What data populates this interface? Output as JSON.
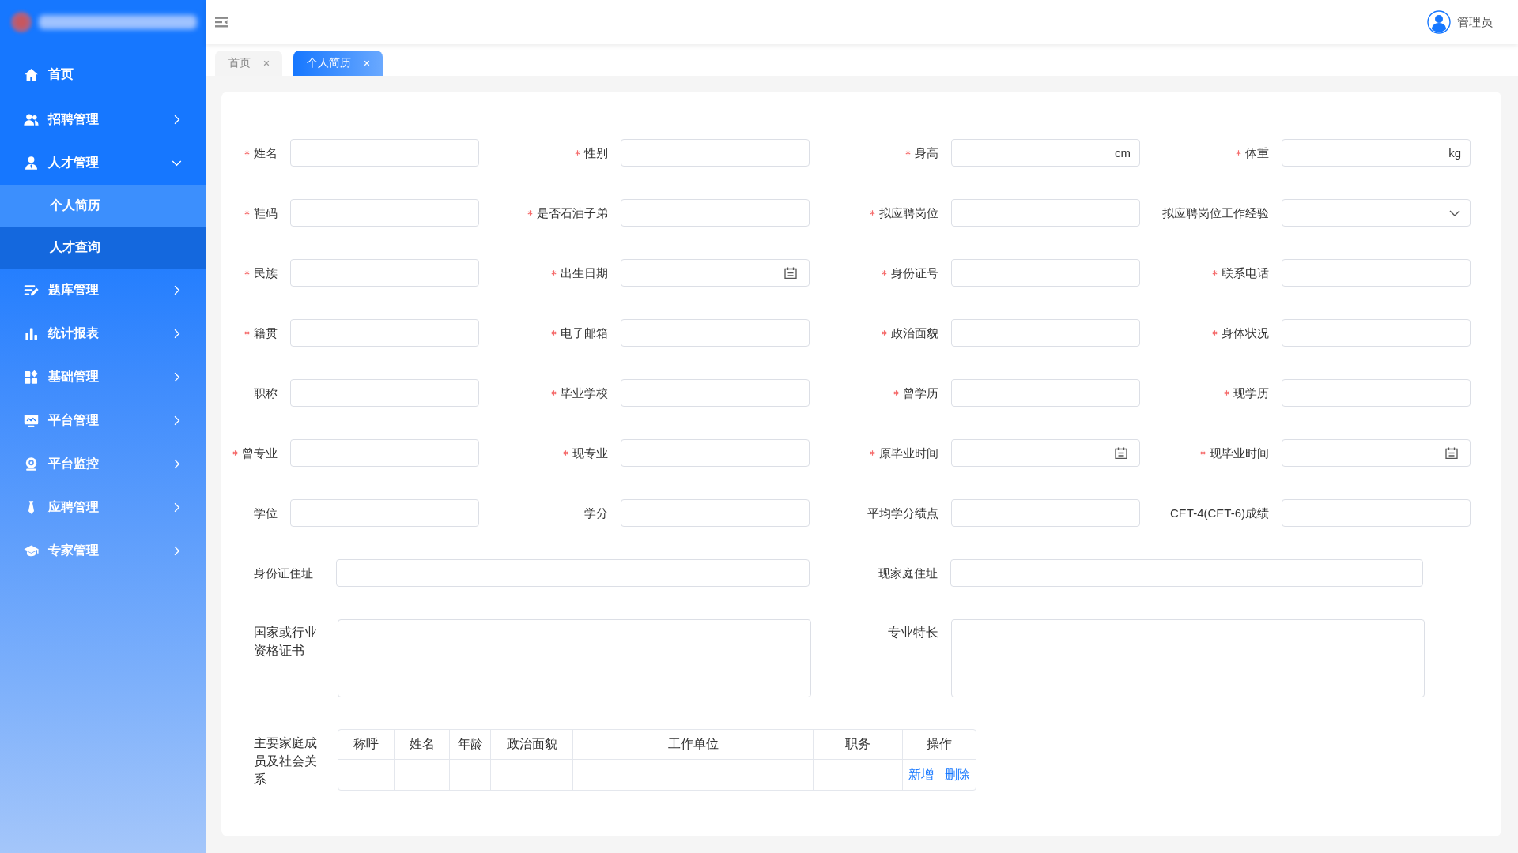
{
  "sidebar": {
    "items": [
      {
        "label": "首页",
        "kind": "link"
      },
      {
        "label": "招聘管理",
        "kind": "group",
        "expanded": false
      },
      {
        "label": "人才管理",
        "kind": "group",
        "expanded": true,
        "children": [
          {
            "label": "个人简历",
            "selected": true
          },
          {
            "label": "人才查询",
            "selected": false
          }
        ]
      },
      {
        "label": "题库管理",
        "kind": "group",
        "expanded": false
      },
      {
        "label": "统计报表",
        "kind": "group",
        "expanded": false
      },
      {
        "label": "基础管理",
        "kind": "group",
        "expanded": false
      },
      {
        "label": "平台管理",
        "kind": "group",
        "expanded": false
      },
      {
        "label": "平台监控",
        "kind": "group",
        "expanded": false
      },
      {
        "label": "应聘管理",
        "kind": "group",
        "expanded": false
      },
      {
        "label": "专家管理",
        "kind": "group",
        "expanded": false
      }
    ]
  },
  "header": {
    "user": "管理员"
  },
  "tabs": [
    {
      "label": "首页",
      "selected": false
    },
    {
      "label": "个人简历",
      "selected": true
    }
  ],
  "form": {
    "fields": [
      {
        "label": "姓名",
        "required": true,
        "kind": "text"
      },
      {
        "label": "性别",
        "required": true,
        "kind": "text"
      },
      {
        "label": "身高",
        "required": true,
        "kind": "unit",
        "unit": "cm"
      },
      {
        "label": "体重",
        "required": true,
        "kind": "unit",
        "unit": "kg"
      },
      {
        "label": "鞋码",
        "required": true,
        "kind": "text"
      },
      {
        "label": "是否石油子弟",
        "required": true,
        "kind": "text"
      },
      {
        "label": "拟应聘岗位",
        "required": true,
        "kind": "text"
      },
      {
        "label": "拟应聘岗位工作经验",
        "required": false,
        "kind": "select"
      },
      {
        "label": "民族",
        "required": true,
        "kind": "text"
      },
      {
        "label": "出生日期",
        "required": true,
        "kind": "date"
      },
      {
        "label": "身份证号",
        "required": true,
        "kind": "text"
      },
      {
        "label": "联系电话",
        "required": true,
        "kind": "text"
      },
      {
        "label": "籍贯",
        "required": true,
        "kind": "text"
      },
      {
        "label": "电子邮箱",
        "required": true,
        "kind": "text"
      },
      {
        "label": "政治面貌",
        "required": true,
        "kind": "text"
      },
      {
        "label": "身体状况",
        "required": true,
        "kind": "text"
      },
      {
        "label": "职称",
        "required": false,
        "kind": "text"
      },
      {
        "label": "毕业学校",
        "required": true,
        "kind": "text"
      },
      {
        "label": "曾学历",
        "required": true,
        "kind": "text"
      },
      {
        "label": "现学历",
        "required": true,
        "kind": "text"
      },
      {
        "label": "曾专业",
        "required": true,
        "kind": "text"
      },
      {
        "label": "现专业",
        "required": true,
        "kind": "text"
      },
      {
        "label": "原毕业时间",
        "required": true,
        "kind": "date"
      },
      {
        "label": "现毕业时间",
        "required": true,
        "kind": "date"
      },
      {
        "label": "学位",
        "required": false,
        "kind": "text"
      },
      {
        "label": "学分",
        "required": false,
        "kind": "text"
      },
      {
        "label": "平均学分绩点",
        "required": false,
        "kind": "text"
      },
      {
        "label": "CET-4(CET-6)成绩",
        "required": false,
        "kind": "text"
      }
    ],
    "wide_fields": [
      {
        "label": "身份证住址",
        "required": false
      },
      {
        "label": "现家庭住址",
        "required": false
      }
    ],
    "textareas": [
      {
        "label": "国家或行业资格证书",
        "required": false
      },
      {
        "label": "专业特长",
        "required": false
      }
    ],
    "family_table": {
      "label": "主要家庭成员及社会关系",
      "columns": [
        "称呼",
        "姓名",
        "年龄",
        "政治面貌",
        "工作单位",
        "职务",
        "操作"
      ],
      "rows": [
        {
          "actions": [
            "新增",
            "删除"
          ]
        }
      ]
    }
  }
}
